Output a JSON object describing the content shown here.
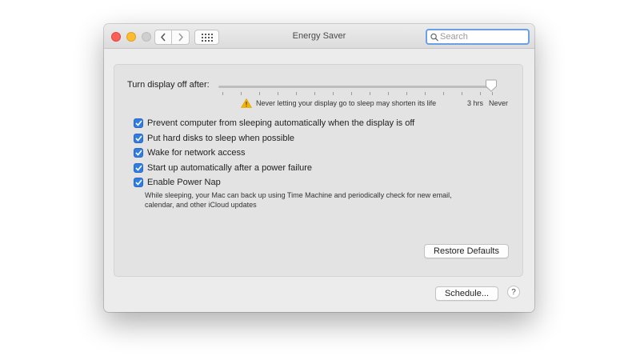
{
  "window": {
    "title": "Energy Saver",
    "search_placeholder": "Search"
  },
  "display_sleep": {
    "label": "Turn display off after:",
    "value": "Never",
    "warning": "Never letting your display go to sleep may shorten its life",
    "tick_labels": [
      "3 hrs",
      "Never"
    ]
  },
  "options": [
    {
      "label": "Prevent computer from sleeping automatically when the display is off",
      "checked": true
    },
    {
      "label": "Put hard disks to sleep when possible",
      "checked": true
    },
    {
      "label": "Wake for network access",
      "checked": true
    },
    {
      "label": "Start up automatically after a power failure",
      "checked": true
    },
    {
      "label": "Enable Power Nap",
      "checked": true
    }
  ],
  "power_nap_description": "While sleeping, your Mac can back up using Time Machine and periodically check for new email, calendar, and other iCloud updates",
  "buttons": {
    "restore_defaults": "Restore Defaults",
    "schedule": "Schedule...",
    "help": "?"
  },
  "colors": {
    "checkbox": "#2f7de1",
    "warning": "#f5b400",
    "search_focus": "#6d9fe4"
  }
}
